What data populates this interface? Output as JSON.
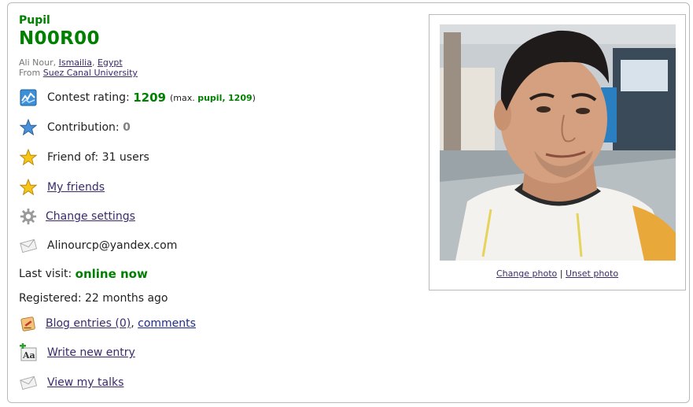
{
  "profile": {
    "rank": "Pupil",
    "handle": "N00R00",
    "name": "Ali Nour",
    "city": "Ismailia",
    "country": "Egypt",
    "from_label": "From",
    "organization": "Suez Canal University"
  },
  "stats": {
    "rating_label": "Contest rating:",
    "rating_value": "1209",
    "rating_max_prefix": "(max.",
    "rating_max_rank": "pupil,",
    "rating_max_value": "1209",
    "rating_max_suffix": ")",
    "contribution_label": "Contribution:",
    "contribution_value": "0",
    "friend_of": "Friend of: 31 users",
    "my_friends": "My friends",
    "change_settings": "Change settings",
    "email": "Alinourcp@yandex.com",
    "last_visit_label": "Last visit:",
    "last_visit_value": "online now",
    "registered": "Registered: 22 months ago",
    "blog_entries": "Blog entries (0)",
    "comments": "comments",
    "write_new_entry": "Write new entry",
    "view_my_talks": "View my talks"
  },
  "photo": {
    "change": "Change photo",
    "separator": "|",
    "unset": "Unset photo"
  },
  "colors": {
    "pupil_green": "#008000",
    "link": "#3b2a6b",
    "border": "#b9b9b9"
  },
  "icons": [
    "rating-chart-icon",
    "blue-star-icon",
    "gold-star-icon",
    "gold-star-icon",
    "gear-icon",
    "envelope-icon",
    "blog-icon",
    "write-entry-icon",
    "envelope-icon"
  ]
}
